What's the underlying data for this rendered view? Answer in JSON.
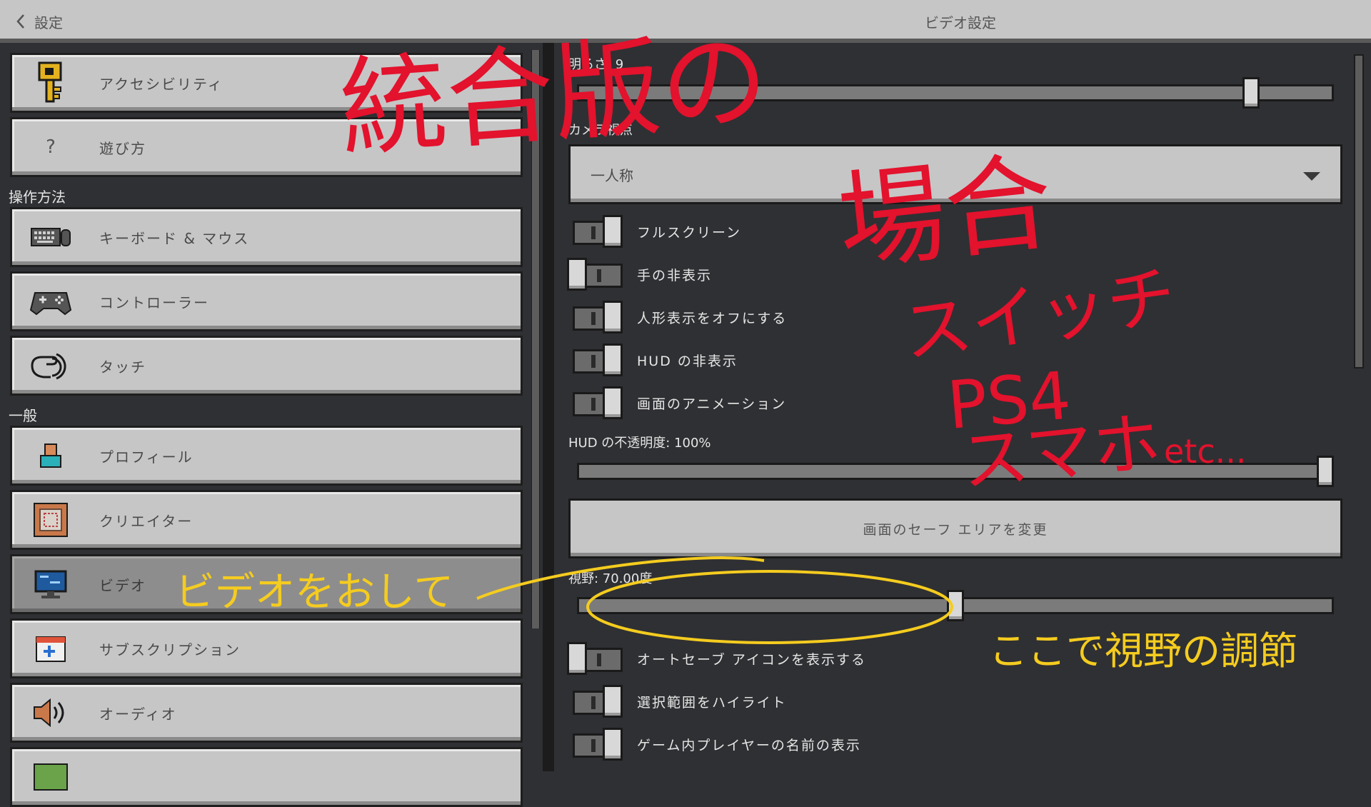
{
  "header": {
    "back_label": "設定",
    "title": "ビデオ設定"
  },
  "sidebar": {
    "items_top": [
      {
        "label": "アクセシビリティ",
        "icon": "key-icon"
      },
      {
        "label": "遊び方",
        "icon": "question-icon"
      }
    ],
    "section_controls": "操作方法",
    "items_controls": [
      {
        "label": "キーボード & マウス",
        "icon": "keyboard-icon"
      },
      {
        "label": "コントローラー",
        "icon": "gamepad-icon"
      },
      {
        "label": "タッチ",
        "icon": "touch-icon"
      }
    ],
    "section_general": "一般",
    "items_general": [
      {
        "label": "プロフィール",
        "icon": "profile-icon"
      },
      {
        "label": "クリエイター",
        "icon": "creator-icon"
      },
      {
        "label": "ビデオ",
        "icon": "monitor-icon",
        "selected": true
      },
      {
        "label": "サブスクリプション",
        "icon": "subscription-icon"
      },
      {
        "label": "オーディオ",
        "icon": "speaker-icon"
      },
      {
        "label": "",
        "icon": "map-icon"
      }
    ]
  },
  "settings": {
    "brightness_label": "明るさ: 9",
    "brightness_value": 0.9,
    "camera_label": "カメラ視点",
    "camera_value": "一人称",
    "toggles1": [
      {
        "label": "フルスクリーン",
        "on": true
      },
      {
        "label": "手の非表示",
        "on": false
      },
      {
        "label": "人形表示をオフにする",
        "on": true
      },
      {
        "label": "HUD の非表示",
        "on": true
      },
      {
        "label": "画面のアニメーション",
        "on": true
      }
    ],
    "hud_opacity_label": "HUD の不透明度: 100%",
    "hud_opacity_value": 1.0,
    "safe_area_button": "画面のセーフ エリアを変更",
    "fov_label": "視野: 70.00度",
    "fov_value": 0.5,
    "toggles2": [
      {
        "label": "オートセーブ アイコンを表示する",
        "on": false
      },
      {
        "label": "選択範囲をハイライト",
        "on": true
      },
      {
        "label": "ゲーム内プレイヤーの名前の表示",
        "on": true
      }
    ]
  },
  "annotations": {
    "red_title_1": "統合版の",
    "red_title_2": "場合",
    "red_platform_1": "スイッチ",
    "red_platform_2": "PS4",
    "red_platform_3": "スマホ",
    "red_etc": "etc...",
    "yellow_press": "ビデオをおして",
    "yellow_adjust": "ここで視野の調節"
  },
  "colors": {
    "annotation_red": "#e3122d",
    "annotation_yellow": "#f5cc1f",
    "panel_gray": "#c6c6c6",
    "background": "#2f3033"
  }
}
